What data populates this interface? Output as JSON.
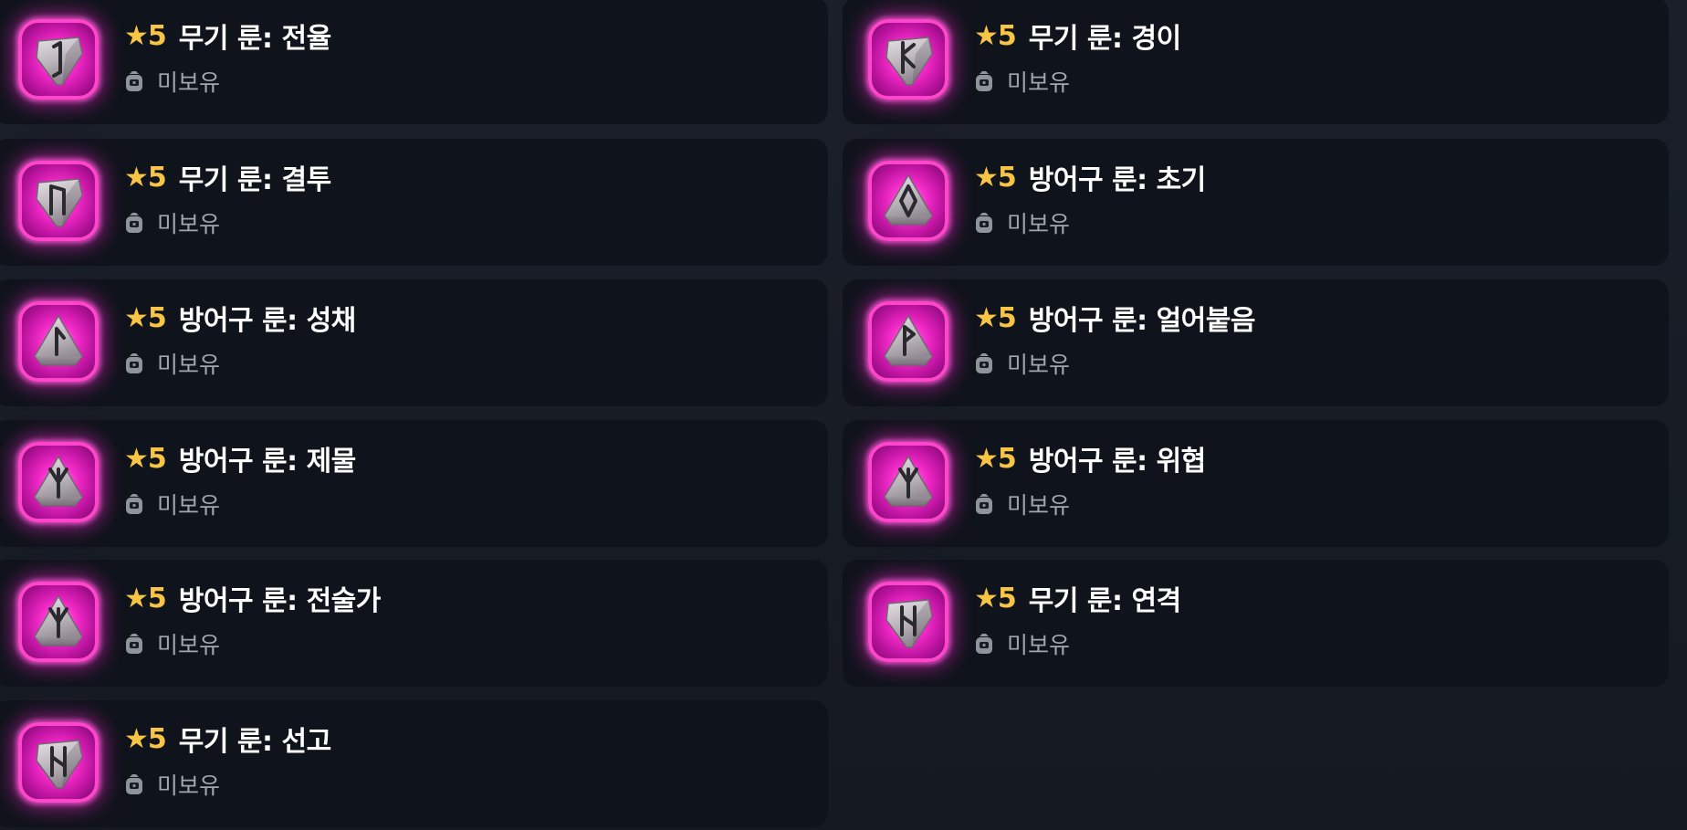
{
  "colors": {
    "star": "#f7c445",
    "title": "#ffffff",
    "status": "#a2a6ad",
    "card_bg": "#0f131b",
    "rune_frame": "#ff45c9"
  },
  "runes": [
    {
      "stars": "★5",
      "name": "무기 룬: 전율",
      "status": "미보유",
      "status_icon": "bag-icon",
      "glyph": "rune-eihwaz-icon",
      "shape": "shield"
    },
    {
      "stars": "★5",
      "name": "무기 룬: 경이",
      "status": "미보유",
      "status_icon": "bag-icon",
      "glyph": "rune-kenaz-icon",
      "shape": "shield"
    },
    {
      "stars": "★5",
      "name": "무기 룬: 결투",
      "status": "미보유",
      "status_icon": "bag-icon",
      "glyph": "rune-uruz-icon",
      "shape": "shield"
    },
    {
      "stars": "★5",
      "name": "방어구 룬: 초기",
      "status": "미보유",
      "status_icon": "bag-icon",
      "glyph": "rune-ingwaz-icon",
      "shape": "triangle"
    },
    {
      "stars": "★5",
      "name": "방어구 룬: 성채",
      "status": "미보유",
      "status_icon": "bag-icon",
      "glyph": "rune-laguz-icon",
      "shape": "triangle"
    },
    {
      "stars": "★5",
      "name": "방어구 룬: 얼어붙음",
      "status": "미보유",
      "status_icon": "bag-icon",
      "glyph": "rune-wunjo-icon",
      "shape": "triangle"
    },
    {
      "stars": "★5",
      "name": "방어구 룬: 제물",
      "status": "미보유",
      "status_icon": "bag-icon",
      "glyph": "rune-algiz-icon",
      "shape": "triangle"
    },
    {
      "stars": "★5",
      "name": "방어구 룬: 위협",
      "status": "미보유",
      "status_icon": "bag-icon",
      "glyph": "rune-algiz-icon",
      "shape": "triangle"
    },
    {
      "stars": "★5",
      "name": "방어구 룬: 전술가",
      "status": "미보유",
      "status_icon": "bag-icon",
      "glyph": "rune-algiz-icon",
      "shape": "triangle"
    },
    {
      "stars": "★5",
      "name": "무기 룬: 연격",
      "status": "미보유",
      "status_icon": "bag-icon",
      "glyph": "rune-hagalaz-icon",
      "shape": "shield"
    },
    {
      "stars": "★5",
      "name": "무기 룬: 선고",
      "status": "미보유",
      "status_icon": "bag-icon",
      "glyph": "rune-hagalaz-icon",
      "shape": "shield"
    }
  ]
}
